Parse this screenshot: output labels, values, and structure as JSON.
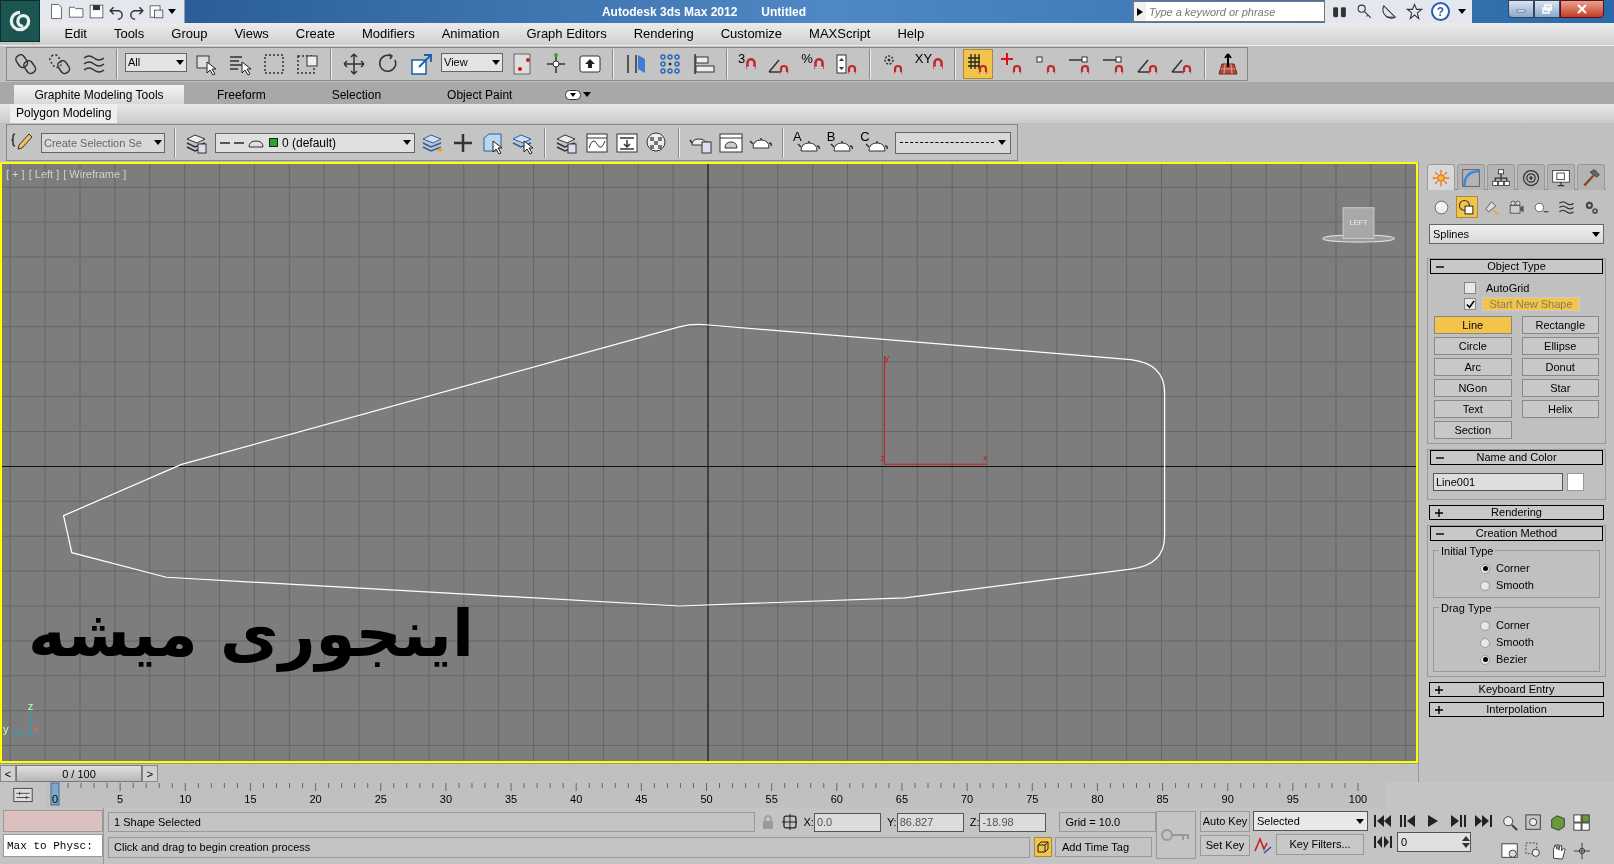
{
  "title_bar": {
    "app": "Autodesk 3ds Max  2012",
    "document": "Untitled",
    "search": {
      "placeholder": "Type a keyword or phrase"
    },
    "help_glyph": "?"
  },
  "menu": [
    "Edit",
    "Tools",
    "Group",
    "Views",
    "Create",
    "Modifiers",
    "Animation",
    "Graph Editors",
    "Rendering",
    "Customize",
    "MAXScript",
    "Help"
  ],
  "main_toolbar": [
    {
      "kind": "icon",
      "on": false
    },
    {
      "kind": "icon",
      "on": false
    },
    {
      "kind": "icon",
      "on": false
    },
    {
      "kind": "sep"
    },
    {
      "kind": "dropdown",
      "value": "All"
    },
    {
      "kind": "icon",
      "on": false
    },
    {
      "kind": "icon",
      "on": false
    },
    {
      "kind": "icon",
      "on": false
    },
    {
      "kind": "icon",
      "on": false
    },
    {
      "kind": "sep"
    },
    {
      "kind": "icon",
      "on": false
    },
    {
      "kind": "icon",
      "on": false
    },
    {
      "kind": "icon",
      "on": false
    },
    {
      "kind": "dropdown",
      "value": "View"
    },
    {
      "kind": "icon",
      "on": false
    },
    {
      "kind": "icon",
      "on": false
    },
    {
      "kind": "icon",
      "on": false
    },
    {
      "kind": "sep"
    },
    {
      "kind": "icon",
      "on": false
    },
    {
      "kind": "icon",
      "on": false
    },
    {
      "kind": "icon",
      "on": false
    },
    {
      "kind": "sep"
    },
    {
      "kind": "icon",
      "glyph": "3",
      "on": false
    },
    {
      "kind": "icon",
      "on": false
    },
    {
      "kind": "icon",
      "glyph": "%",
      "on": false
    },
    {
      "kind": "icon",
      "on": false
    },
    {
      "kind": "sep"
    },
    {
      "kind": "icon",
      "on": false
    },
    {
      "kind": "icon",
      "glyph": "XY",
      "on": false
    },
    {
      "kind": "sep"
    },
    {
      "kind": "icon",
      "on": true
    },
    {
      "kind": "icon",
      "on": false
    },
    {
      "kind": "icon",
      "on": false
    },
    {
      "kind": "icon",
      "on": false
    },
    {
      "kind": "icon",
      "on": false
    },
    {
      "kind": "icon",
      "on": false
    },
    {
      "kind": "icon",
      "on": false
    },
    {
      "kind": "sep"
    },
    {
      "kind": "icon",
      "on": false
    }
  ],
  "ribbon": {
    "tabs": [
      {
        "label": "Graphite Modeling Tools",
        "selected": true
      },
      {
        "label": "Freeform",
        "selected": false
      },
      {
        "label": "Selection",
        "selected": false
      },
      {
        "label": "Object Paint",
        "selected": false
      }
    ],
    "panel": "Polygon Modeling"
  },
  "ribbon_toolbar": [
    {
      "kind": "icon"
    },
    {
      "kind": "dropdown",
      "placeholder": "Create Selection Se"
    },
    {
      "kind": "sep"
    },
    {
      "kind": "icon"
    },
    {
      "kind": "layer",
      "value": "0 (default)",
      "color": "#1fae1f"
    },
    {
      "kind": "icon"
    },
    {
      "kind": "icon"
    },
    {
      "kind": "icon"
    },
    {
      "kind": "icon"
    },
    {
      "kind": "sep"
    },
    {
      "kind": "icon"
    },
    {
      "kind": "icon"
    },
    {
      "kind": "icon"
    },
    {
      "kind": "icon"
    },
    {
      "kind": "sep"
    },
    {
      "kind": "icon"
    },
    {
      "kind": "icon"
    },
    {
      "kind": "icon"
    },
    {
      "kind": "sep"
    },
    {
      "kind": "icon",
      "glyph": "A"
    },
    {
      "kind": "icon",
      "glyph": "B"
    },
    {
      "kind": "icon",
      "glyph": "C"
    },
    {
      "kind": "linestyle"
    }
  ],
  "viewport": {
    "labels": [
      "[ + ]",
      "[ Left ]",
      "[ Wireframe ]"
    ],
    "view_cube": "LEFT",
    "gizmo_labels": [
      "y",
      "z",
      "x"
    ],
    "tripod_labels": [
      "z",
      "y",
      "x"
    ],
    "annotation": "اینجوری میشه"
  },
  "time_slider": {
    "prev": "<",
    "position": "0 / 100",
    "next": ">"
  },
  "track_bar": {
    "ticks": [
      "0",
      "5",
      "10",
      "15",
      "20",
      "25",
      "30",
      "35",
      "40",
      "45",
      "50",
      "55",
      "60",
      "65",
      "70",
      "75",
      "80",
      "85",
      "90",
      "95",
      "100"
    ]
  },
  "command_panel": {
    "tabs": [
      {
        "selected": true
      },
      {
        "selected": false
      },
      {
        "selected": false
      },
      {
        "selected": false
      },
      {
        "selected": false
      },
      {
        "selected": false
      }
    ],
    "categories": [
      {
        "selected": false
      },
      {
        "selected": true
      },
      {
        "selected": false
      },
      {
        "selected": false
      },
      {
        "selected": false
      },
      {
        "selected": false
      },
      {
        "selected": false
      }
    ],
    "category_dropdown": "Splines",
    "rollouts": [
      {
        "kind": "object_type",
        "title": "Object Type",
        "expanded": true,
        "autogrid": {
          "label": "AutoGrid",
          "checked": false
        },
        "start_new_shape": {
          "label": "Start New Shape",
          "checked": true
        },
        "buttons": [
          {
            "label": "Line",
            "selected": true
          },
          {
            "label": "Rectangle",
            "selected": false
          },
          {
            "label": "Circle",
            "selected": false
          },
          {
            "label": "Ellipse",
            "selected": false
          },
          {
            "label": "Arc",
            "selected": false
          },
          {
            "label": "Donut",
            "selected": false
          },
          {
            "label": "NGon",
            "selected": false
          },
          {
            "label": "Star",
            "selected": false
          },
          {
            "label": "Text",
            "selected": false
          },
          {
            "label": "Helix",
            "selected": false
          },
          {
            "label": "Section",
            "selected": false
          }
        ]
      },
      {
        "kind": "name_color",
        "title": "Name and Color",
        "expanded": true,
        "name": "Line001",
        "color": "#ffffff"
      },
      {
        "title": "Rendering",
        "expanded": false
      },
      {
        "kind": "creation_method",
        "title": "Creation Method",
        "expanded": true,
        "groups": [
          {
            "title": "Initial Type",
            "options": [
              {
                "label": "Corner",
                "selected": true
              },
              {
                "label": "Smooth",
                "selected": false
              }
            ]
          },
          {
            "title": "Drag Type",
            "options": [
              {
                "label": "Corner",
                "selected": false
              },
              {
                "label": "Smooth",
                "selected": false
              },
              {
                "label": "Bezier",
                "selected": true
              }
            ]
          }
        ]
      },
      {
        "title": "Keyboard Entry",
        "expanded": false
      },
      {
        "title": "Interpolation",
        "expanded": false
      }
    ]
  },
  "status": {
    "listener": "Max to Physc:",
    "selection": "1 Shape Selected",
    "prompt": "Click and drag to begin creation process",
    "coordinates": [
      {
        "label": "X:",
        "value": "0.0"
      },
      {
        "label": "Y:",
        "value": "86.827"
      },
      {
        "label": "Z:",
        "value": "-18.98"
      }
    ],
    "grid": "Grid = 10.0",
    "time_tag": "Add Time Tag",
    "auto_key": "Auto Key",
    "set_key": "Set Key",
    "key_mode": "Selected",
    "key_filters": "Key Filters...",
    "frame": "0"
  }
}
